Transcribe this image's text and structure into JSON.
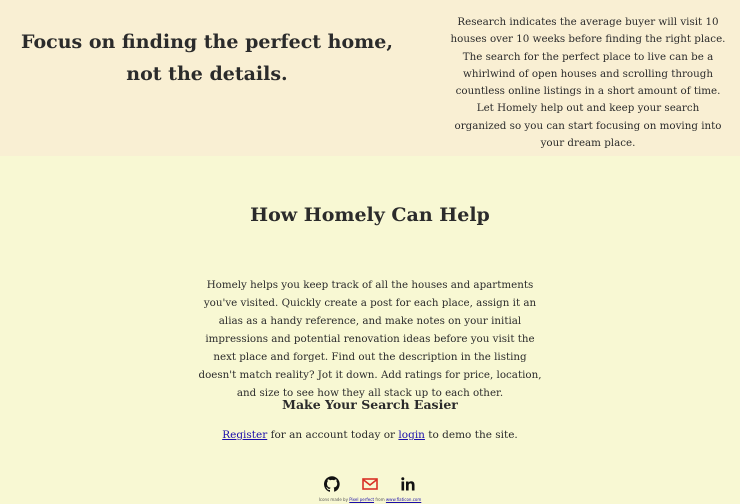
{
  "hero": {
    "headline": "Focus on finding the perfect home, not the details.",
    "research": "Research indicates the average buyer will visit 10 houses over 10 weeks before finding the right place. The search for the perfect place to live can be a whirlwind of open houses and scrolling through countless online listings in a short amount of time. Let Homely help out and keep your search organized so you can start focusing on moving into your dream place."
  },
  "help": {
    "title": "How Homely Can Help",
    "body": "Homely helps you keep track of all the houses and apartments you've visited. Quickly create a post for each place, assign it an alias as a handy reference, and make notes on your initial impressions and potential renovation ideas before you visit the next place and forget. Find out the description in the listing doesn't match reality? Jot it down. Add ratings for price, location, and size to see how they all stack up to each other.",
    "subtitle": "Make Your Search Easier"
  },
  "cta": {
    "register": "Register",
    "middle": " for an account today or ",
    "login": "login",
    "end": " to demo the site."
  },
  "footer": {
    "icons": [
      "github-icon",
      "gmail-icon",
      "linkedin-icon"
    ],
    "credit_prefix": "Icons made by ",
    "credit_author": "Pixel perfect",
    "credit_mid": " from ",
    "credit_site": "www.flaticon.com"
  },
  "colors": {
    "top_bg": "#f9efd3",
    "main_bg": "#f8f8d3",
    "text": "#2b2b2b",
    "link": "#1a0dab",
    "gmail_red": "#d93025"
  }
}
